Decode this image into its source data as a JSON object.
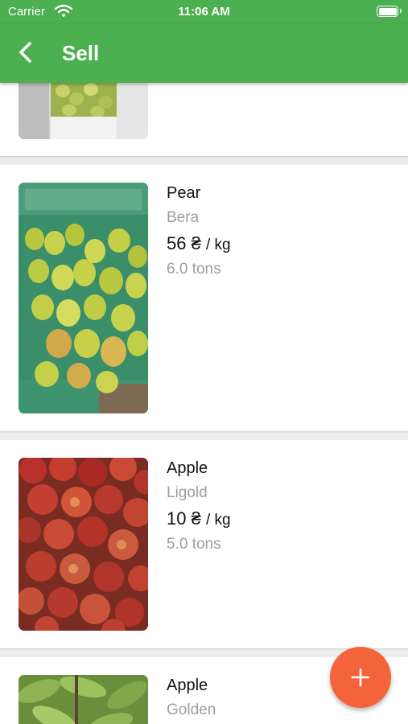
{
  "status_bar": {
    "carrier": "Carrier",
    "time": "11:06 AM"
  },
  "app_bar": {
    "title": "Sell"
  },
  "listings": [
    {
      "name": "Pear",
      "variety": "Bera",
      "price": "56 ₴",
      "unit": "/ kg",
      "quantity": "6.0 tons",
      "photo": "pears-in-green-crate"
    },
    {
      "name": "Apple",
      "variety": "Ligold",
      "price": "10 ₴",
      "unit": "/ kg",
      "quantity": "5.0 tons",
      "photo": "red-apples-pile"
    },
    {
      "name": "Apple",
      "variety": "Golden",
      "photo": "apple-tree-leaves"
    }
  ],
  "fab": {
    "icon": "plus-icon"
  },
  "colors": {
    "app_bar": "#4caf50",
    "fab": "#f4633a"
  }
}
